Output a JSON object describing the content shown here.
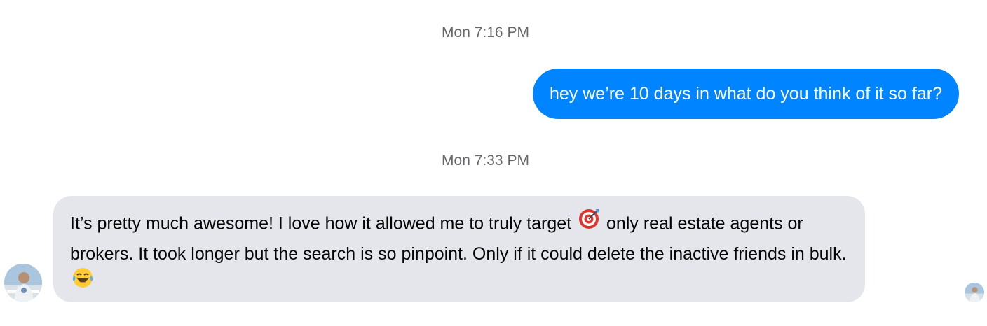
{
  "conversation": {
    "timestamps": [
      "Mon 7:16 PM",
      "Mon 7:33 PM"
    ],
    "outgoing_message": "hey we’re 10 days in what do you think of it so far?",
    "incoming_message": {
      "part1": "It’s pretty much awesome! I love how it allowed me to truly target",
      "part2": "only real estate agents or brokers. It took longer but the search is so pinpoint. Only if it could delete the inactive friends in bulk.",
      "emoji_1": "target-emoji",
      "emoji_2": "laughing-tears-emoji"
    },
    "sender_avatar": "avatar-photo",
    "read_receipt_avatar": "avatar-photo"
  },
  "colors": {
    "outgoing_bubble": "#0084ff",
    "incoming_bubble": "#e4e6eb",
    "timestamp_text": "#65676b"
  }
}
